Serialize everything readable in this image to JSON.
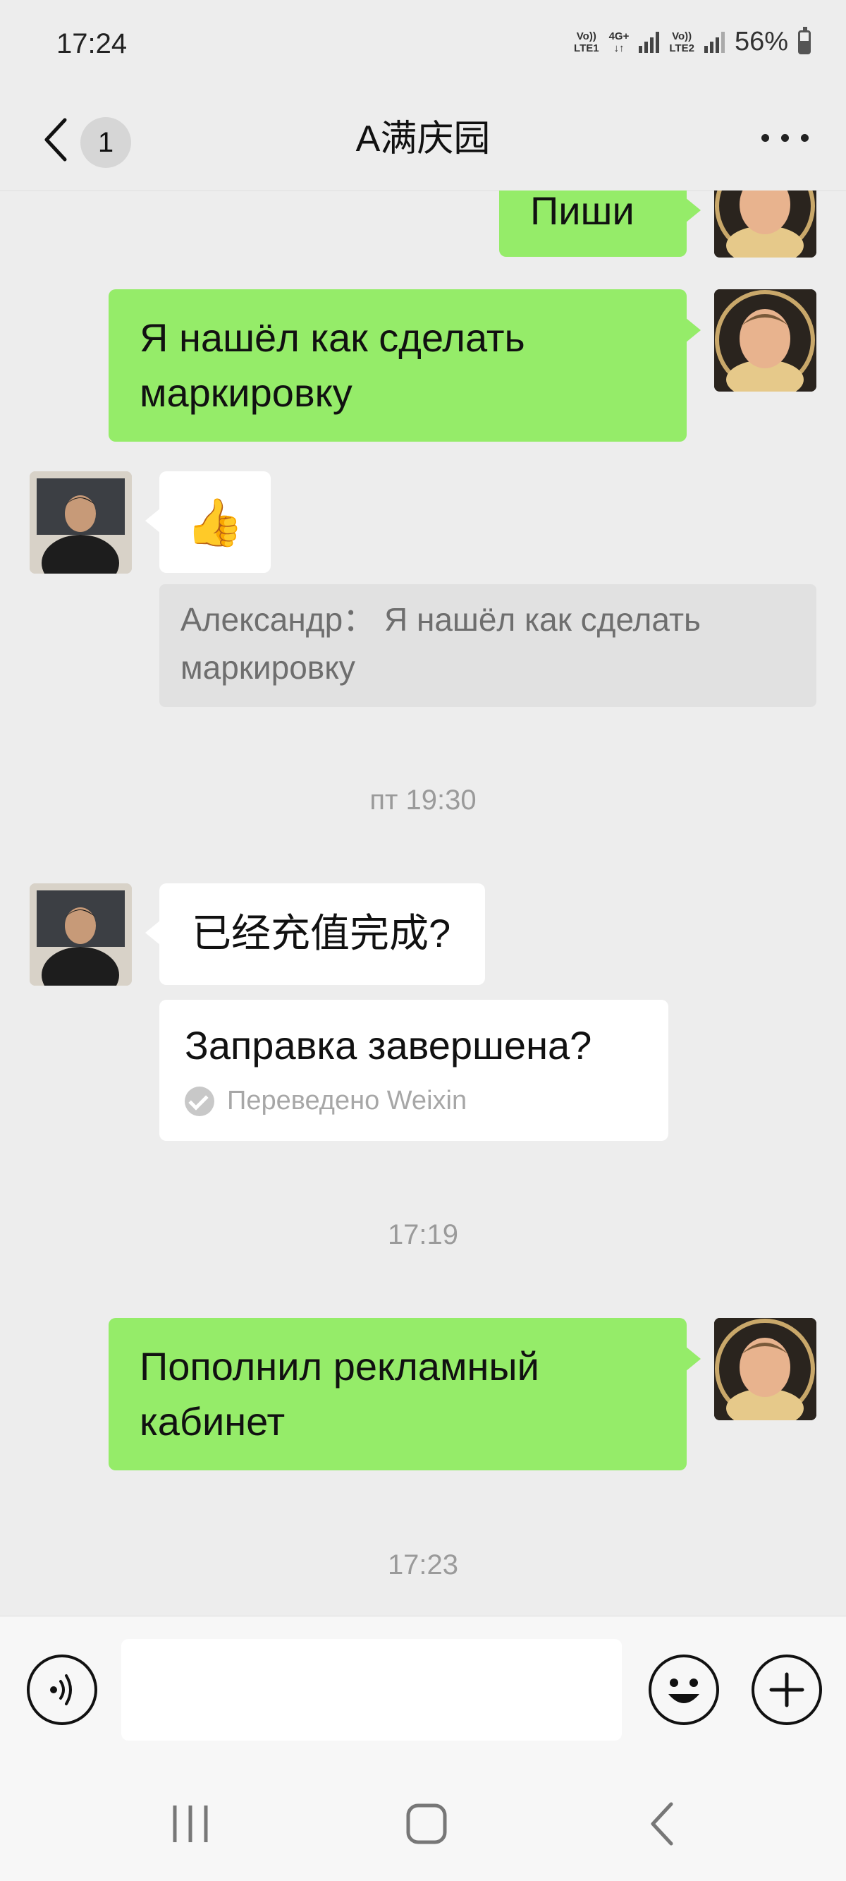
{
  "status_bar": {
    "time": "17:24",
    "network1_top": "Vo))",
    "network1_bottom": "LTE1",
    "network2_top": "4G+",
    "network2_bottom": "↓↑",
    "network3_top": "Vo))",
    "network3_bottom": "LTE2",
    "battery_percent": "56%",
    "battery_level": 0.56
  },
  "header": {
    "back_icon": "chevron-left-icon",
    "unread_count": "1",
    "title": "A满庆园",
    "more_icon": "more-horizontal-icon"
  },
  "messages": [
    {
      "type": "text",
      "side": "self",
      "text": "Пиши"
    },
    {
      "type": "text",
      "side": "self",
      "text": "Я нашёл как сделать маркировку"
    },
    {
      "type": "emoji",
      "side": "other",
      "emoji": "👍",
      "quote": "Александр： Я нашёл как сделать маркировку"
    },
    {
      "type": "time",
      "text": "пт 19:30"
    },
    {
      "type": "text",
      "side": "other",
      "text": "已经充值完成?",
      "translation": "Заправка завершена?",
      "translation_note": "Переведено Weixin"
    },
    {
      "type": "time",
      "text": "17:19"
    },
    {
      "type": "text",
      "side": "self",
      "text": "Пополнил рекламный кабинет"
    },
    {
      "type": "time",
      "text": "17:23"
    }
  ],
  "input_bar": {
    "voice_icon": "voice-icon",
    "placeholder": "",
    "emoji_icon": "smiley-icon",
    "add_icon": "plus-circle-icon"
  },
  "nav_bar": {
    "recents_icon": "recents-icon",
    "home_icon": "home-icon",
    "back_icon": "back-icon"
  },
  "colors": {
    "background": "#ededed",
    "self_bubble": "#95ec69",
    "other_bubble": "#ffffff",
    "quote_bg": "#e1e1e1",
    "timestamp": "#9a9a9a"
  }
}
